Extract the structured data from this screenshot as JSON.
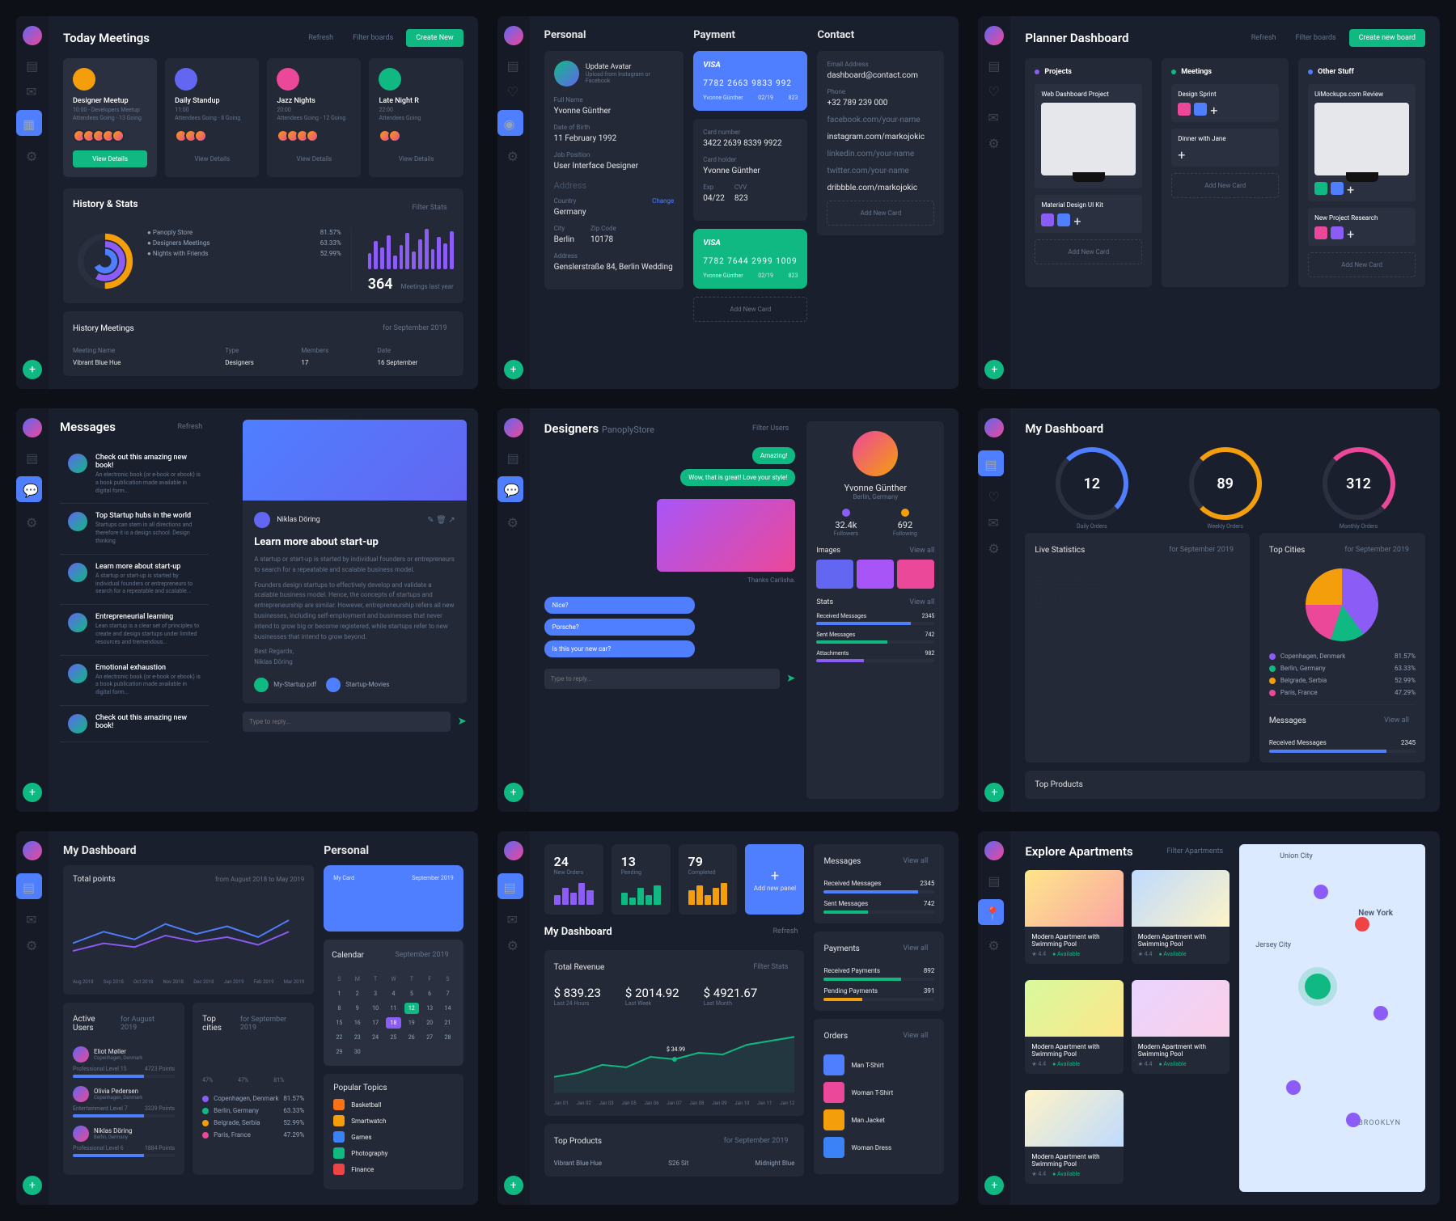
{
  "dash1": {
    "title": "Today Meetings",
    "actions": {
      "refresh": "Refresh",
      "filter": "Filter boards",
      "create": "Create New"
    },
    "meetings": [
      {
        "title": "Designer Meetup",
        "sub": "10:00 - Developers Meetup",
        "attendees": "Attendees Going - 13 Going"
      },
      {
        "title": "Daily Standup",
        "sub": "11:00",
        "attendees": "Attendees Going - 8 Going"
      },
      {
        "title": "Jazz Nights",
        "sub": "20:00",
        "attendees": "Attendees Going - 12 Going"
      },
      {
        "title": "Late Night R",
        "sub": "22:00",
        "attendees": "Attendees Going"
      }
    ],
    "viewDetails": "View Details",
    "history": {
      "title": "History & Stats",
      "filter": "Filter Stats",
      "items": [
        {
          "name": "Panoply Store",
          "pct": "81.57%"
        },
        {
          "name": "Designers Meetings",
          "pct": "63.33%"
        },
        {
          "name": "Nights with Friends",
          "pct": "52.99%"
        }
      ],
      "count": "364",
      "countLabel": "Meetings last year"
    },
    "historyMeetings": {
      "title": "History Meetings",
      "period": "for September 2019",
      "cols": [
        "Meeting Name",
        "Type",
        "Members",
        "Date"
      ],
      "row": [
        "Vibrant Blue Hue",
        "Designers",
        "17",
        "16 September"
      ]
    }
  },
  "dash2": {
    "cols": [
      "Personal",
      "Payment",
      "Contact"
    ],
    "personal": {
      "name": "Update Avatar",
      "hint": "Upload from Instagram or Facebook",
      "fields": [
        {
          "label": "Full Name",
          "val": "Yvonne Günther"
        },
        {
          "label": "Date of Birth",
          "val": "11 February 1992"
        },
        {
          "label": "Job Position",
          "val": "User Interface Designer"
        }
      ],
      "addressTitle": "Address",
      "address": [
        {
          "label": "Country",
          "val": "Germany",
          "extra": "Change"
        },
        {
          "label": "City",
          "val": "Berlin",
          "zipLabel": "Zip Code",
          "zip": "10178"
        },
        {
          "label": "Address",
          "val": "Genslerstraße 84, Berlin Wedding"
        }
      ]
    },
    "cards": [
      {
        "brand": "VISA",
        "num": "7782 2663 9833 992",
        "name": "Yvonne Günther",
        "exp": "02/19",
        "cvv": "823"
      },
      {
        "brand": "VISA",
        "num": "7782 7644 2999 1009",
        "name": "Yvonne Günther",
        "exp": "02/19",
        "cvv": "823"
      }
    ],
    "inputs": [
      {
        "label": "Card number",
        "val": "3422 2639 8339 9922"
      },
      {
        "label": "Card holder",
        "val": "Yvonne Günther"
      },
      {
        "label": "Exp",
        "val": "04/22",
        "label2": "CVV",
        "val2": "823"
      }
    ],
    "addCard": "Add New Card",
    "contact": {
      "email": {
        "label": "Email Address",
        "val": "dashboard@contact.com"
      },
      "phone": {
        "label": "Phone",
        "val": "+32 789 239 000"
      },
      "fb": {
        "label": "facebook.com/your-name"
      },
      "ig": {
        "label": "instagram.com/markojokic"
      },
      "li": {
        "label": "linkedin.com/your-name"
      },
      "tw": {
        "label": "twitter.com/your-name"
      },
      "dr": {
        "label": "dribbble.com/markojokic"
      }
    }
  },
  "dash3": {
    "title": "Planner Dashboard",
    "actions": {
      "refresh": "Refresh",
      "filter": "Filter boards",
      "create": "Create new board"
    },
    "cols": [
      {
        "name": "Projects",
        "items": [
          {
            "title": "Web Dashboard Project",
            "mockup": true
          },
          {
            "title": "Material Design UI Kit"
          }
        ]
      },
      {
        "name": "Meetings",
        "items": [
          {
            "title": "Design Sprint"
          },
          {
            "title": "Dinner with Jane"
          }
        ]
      },
      {
        "name": "Other Stuff",
        "items": [
          {
            "title": "UiMockups.com Review",
            "mockup": true
          },
          {
            "title": "New Project Research"
          }
        ]
      }
    ],
    "addCard": "Add New Card"
  },
  "dash4": {
    "title": "Messages",
    "refresh": "Refresh",
    "messages": [
      {
        "t": "Check out this amazing new book!",
        "s": "An electronic book (or e-book or ebook) is a book publication made available in digital form..."
      },
      {
        "t": "Top Startup hubs in the world",
        "s": "Startups can stem in all directions and therefore it is a design school. Design thinking"
      },
      {
        "t": "Learn more about start-up",
        "s": "A startup or start-up is started by individual founders or entrepreneurs to search for a repeatable and scalable..."
      },
      {
        "t": "Entrepreneurial learning",
        "s": "Lean startup is a clear set of principles to create and design startups under limited resources and tremendous..."
      },
      {
        "t": "Emotional exhaustion",
        "s": "An electronic book (or e-book or ebook) is a book publication made available in digital form..."
      },
      {
        "t": "Check out this amazing new book!",
        "s": ""
      }
    ],
    "article": {
      "author": "Niklas Döring",
      "title": "Learn more about start-up",
      "p1": "A startup or start-up is started by individual founders or entrepreneurs to search for a repeatable and scalable business model.",
      "p2": "Founders design startups to effectively develop and validate a scalable business model. Hence, the concepts of startups and entrepreneurship are similar. However, entrepreneurship refers all new businesses, including self-employment and businesses that never intend to grow big or become registered, while startups refer to new businesses that intend to grow beyond.",
      "sign": "Best Regards,\nNiklas Döring",
      "attachments": [
        {
          "name": "My-Startup.pdf"
        },
        {
          "name": "Startup-Movies"
        }
      ],
      "reply": "Type to reply..."
    }
  },
  "dash5": {
    "title": "Designers",
    "crumb": "PanoplyStore",
    "filter": "Filter Users",
    "bubbles": [
      {
        "me": true,
        "text": "Amazing!"
      },
      {
        "me": true,
        "text": "Wow, that is great! Love your style!"
      },
      {
        "them": true,
        "text": "Nice?"
      },
      {
        "them": true,
        "text": "Porsche?"
      },
      {
        "them": true,
        "text": "Is this your new car?"
      }
    ],
    "thanks": "Thanks Carlisha.",
    "reply": "Type to reply...",
    "profile": {
      "name": "Yvonne Günther",
      "loc": "Berlin, Germany",
      "stats": [
        {
          "n": "32.4k",
          "l": "Followers"
        },
        {
          "n": "692",
          "l": "Following"
        }
      ],
      "imagesTitle": "Images",
      "viewAll": "View all",
      "statsTitle": "Stats",
      "bars": [
        {
          "l": "Received Messages",
          "v": "2345"
        },
        {
          "l": "Sent Messages",
          "v": "742"
        },
        {
          "l": "Attachments",
          "v": "982"
        }
      ]
    }
  },
  "dash6": {
    "title": "My Dashboard",
    "rings": [
      {
        "n": "12",
        "l": "Daily Orders"
      },
      {
        "n": "89",
        "l": "Weekly Orders"
      },
      {
        "n": "312",
        "l": "Monthly Orders"
      }
    ],
    "live": {
      "title": "Live Statistics",
      "period": "for September 2019"
    },
    "topCities": {
      "title": "Top Cities",
      "period": "for September 2019",
      "items": [
        {
          "c": "#8b5cf6",
          "l": "Copenhagen, Denmark",
          "v": "81.57%"
        },
        {
          "c": "#10b981",
          "l": "Berlin, Germany",
          "v": "63.33%"
        },
        {
          "c": "#f59e0b",
          "l": "Belgrade, Serbia",
          "v": "52.99%"
        },
        {
          "c": "#ec4899",
          "l": "Paris, France",
          "v": "47.29%"
        }
      ]
    },
    "messages": {
      "title": "Messages",
      "viewAll": "View all",
      "bar": {
        "l": "Received Messages",
        "v": "2345"
      }
    },
    "topProducts": "Top Products"
  },
  "dash7": {
    "title": "My Dashboard",
    "personal": "Personal",
    "points": {
      "title": "Total points",
      "from": "from August 2018",
      "to": "to May 2019",
      "axis": [
        "Aug 2018",
        "Sep 2018",
        "Oct 2018",
        "Nov 2018",
        "Dec 2018",
        "Jan 2019",
        "Feb 2019",
        "Mar 2019"
      ]
    },
    "myCard": {
      "title": "My Card",
      "period": "September 2019"
    },
    "calendar": {
      "title": "Calendar",
      "period": "September 2019",
      "days": [
        "S",
        "M",
        "T",
        "W",
        "T",
        "F",
        "S"
      ]
    },
    "activeUsers": {
      "title": "Active Users",
      "period": "for August 2019",
      "users": [
        {
          "n": "Eliot Møller",
          "loc": "Copenhagen, Denmark",
          "lvl": "Professional Level 15",
          "pts": "4723 Points"
        },
        {
          "n": "Olivia Pedersen",
          "loc": "Copenhagen, Denmark",
          "lvl": "Entertainment Level 7",
          "pts": "3339 Points"
        },
        {
          "n": "Niklas Döring",
          "loc": "Berlin, Germany",
          "lvl": "Professional Level 6",
          "pts": "1884 Points"
        }
      ]
    },
    "topCities": {
      "title": "Top cities",
      "period": "for September 2019",
      "bars": [
        {
          "v": "47%"
        },
        {
          "v": "47%"
        },
        {
          "v": "81%"
        }
      ],
      "items": [
        {
          "c": "#8b5cf6",
          "l": "Copenhagen, Denmark",
          "v": "81.57%"
        },
        {
          "c": "#10b981",
          "l": "Berlin, Germany",
          "v": "63.33%"
        },
        {
          "c": "#f59e0b",
          "l": "Belgrade, Serbia",
          "v": "52.99%"
        },
        {
          "c": "#ec4899",
          "l": "Paris, France",
          "v": "47.29%"
        }
      ]
    },
    "popular": {
      "title": "Popular Topics",
      "items": [
        {
          "c": "#f97316",
          "l": "Basketball"
        },
        {
          "c": "#f59e0b",
          "l": "Smartwatch"
        },
        {
          "c": "#3b82f6",
          "l": "Games"
        },
        {
          "c": "#10b981",
          "l": "Photography"
        },
        {
          "c": "#ef4444",
          "l": "Finance"
        }
      ]
    }
  },
  "dash8": {
    "top": [
      {
        "n": "24",
        "l": "New Orders"
      },
      {
        "n": "13",
        "l": "Pending"
      },
      {
        "n": "79",
        "l": "Completed"
      }
    ],
    "addPanel": "Add new panel",
    "title": "My Dashboard",
    "refresh": "Refresh",
    "revenue": {
      "title": "Total Revenue",
      "filter": "Filter Stats",
      "items": [
        {
          "v": "$ 839.23",
          "l": "Last 24 Hours"
        },
        {
          "v": "$ 2014.92",
          "l": "Last Week"
        },
        {
          "v": "$ 4921.67",
          "l": "Last Month"
        }
      ],
      "tooltip": "$ 34.99",
      "axis": [
        "Jan 01",
        "Jan 02",
        "Jan 03",
        "Jan 05",
        "Jan 06",
        "Jan 07",
        "Jan 08",
        "Jan 09",
        "Jan 10",
        "Jan 11",
        "Jan 12"
      ]
    },
    "messages": {
      "title": "Messages",
      "viewAll": "View all",
      "items": [
        {
          "l": "Received Messages",
          "v": "2345"
        },
        {
          "l": "Sent Messages",
          "v": "742"
        }
      ]
    },
    "payments": {
      "title": "Payments",
      "viewAll": "View all",
      "items": [
        {
          "l": "Received Payments",
          "v": "892"
        },
        {
          "l": "Pending Payments",
          "v": "391"
        }
      ]
    },
    "orders": {
      "title": "Orders",
      "viewAll": "View all",
      "items": [
        "Man T-Shirt",
        "Woman T-Shirt",
        "Man Jacket",
        "Woman Dress"
      ]
    },
    "topProducts": {
      "title": "Top Products",
      "period": "for September 2019",
      "items": [
        "Vibrant Blue Hue",
        "S26 Sit",
        "Midnight Blue"
      ]
    }
  },
  "dash9": {
    "title": "Explore Apartments",
    "filter": "Filter Apartments",
    "apts": [
      {
        "t": "Modern Apartment with Swimming Pool",
        "r": "4.4",
        "a": "Available"
      },
      {
        "t": "Modern Apartment with Swimming Pool",
        "r": "4.4",
        "a": "Available"
      },
      {
        "t": "Modern Apartment with Swimming Pool",
        "r": "4.4",
        "a": "Available"
      },
      {
        "t": "Modern Apartment with Swimming Pool",
        "r": "4.4",
        "a": "Available"
      },
      {
        "t": "Modern Apartment with Swimming Pool",
        "r": "4.4",
        "a": "Available"
      }
    ],
    "map": {
      "labels": [
        "Union City",
        "Jersey City",
        "New York",
        "BROOKLYN"
      ]
    }
  },
  "chart_data": [
    {
      "type": "bar",
      "title": "Meetings last year",
      "values": [
        20,
        35,
        28,
        42,
        18,
        30,
        45,
        22,
        38,
        50,
        25,
        40,
        33,
        48,
        29,
        36,
        44,
        31
      ],
      "count": 364
    },
    {
      "type": "line",
      "title": "Total points",
      "x": [
        "Aug 2018",
        "Sep 2018",
        "Oct 2018",
        "Nov 2018",
        "Dec 2018",
        "Jan 2019",
        "Feb 2019",
        "Mar 2019"
      ],
      "series": [
        {
          "name": "Blue",
          "values": [
            40,
            55,
            45,
            60,
            50,
            58,
            48,
            62
          ]
        },
        {
          "name": "Purple",
          "values": [
            30,
            42,
            38,
            50,
            45,
            52,
            40,
            55
          ]
        }
      ]
    },
    {
      "type": "line",
      "title": "Total Revenue",
      "x": [
        "Jan 01",
        "Jan 02",
        "Jan 03",
        "Jan 05",
        "Jan 06",
        "Jan 07",
        "Jan 08",
        "Jan 09",
        "Jan 10",
        "Jan 11",
        "Jan 12"
      ],
      "values": [
        20,
        25,
        35,
        30,
        40,
        38,
        45,
        42,
        50,
        55,
        60
      ],
      "tooltip_value": 34.99
    },
    {
      "type": "pie",
      "title": "Top Cities",
      "categories": [
        "Copenhagen",
        "Berlin",
        "Belgrade",
        "Paris"
      ],
      "values": [
        40,
        15,
        20,
        25
      ]
    }
  ]
}
